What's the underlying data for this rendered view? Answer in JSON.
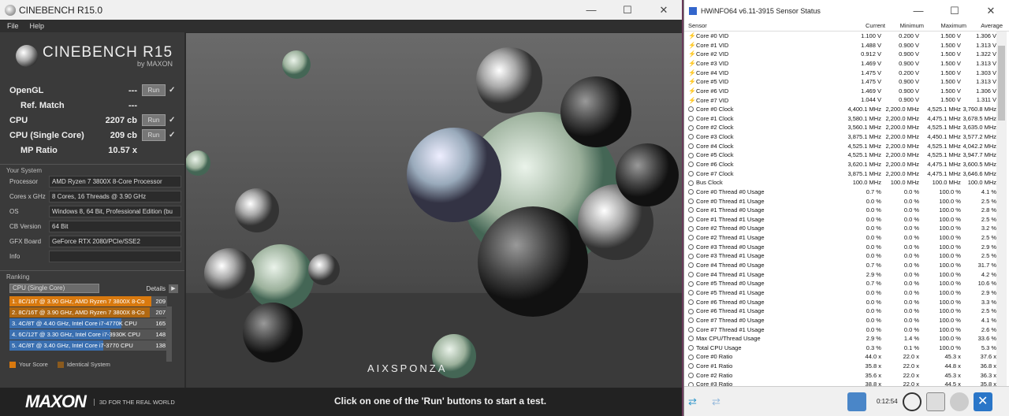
{
  "cinebench": {
    "title": "CINEBENCH R15.0",
    "menu": [
      "File",
      "Help"
    ],
    "logo_main": "CINEBENCH R15",
    "logo_by": "by MAXON",
    "scores": [
      {
        "label": "OpenGL",
        "value": "---",
        "run": "Run",
        "indent": false
      },
      {
        "label": "Ref. Match",
        "value": "---",
        "run": "",
        "indent": true
      },
      {
        "label": "CPU",
        "value": "2207 cb",
        "run": "Run",
        "indent": false
      },
      {
        "label": "CPU (Single Core)",
        "value": "209 cb",
        "run": "Run",
        "indent": false
      },
      {
        "label": "MP Ratio",
        "value": "10.57 x",
        "run": "",
        "indent": true
      }
    ],
    "your_system_label": "Your System",
    "system": [
      {
        "key": "Processor",
        "value": "AMD Ryzen 7 3800X 8-Core Processor"
      },
      {
        "key": "Cores x GHz",
        "value": "8 Cores, 16 Threads @ 3.90 GHz"
      },
      {
        "key": "OS",
        "value": "Windows 8, 64 Bit, Professional Edition (bu"
      },
      {
        "key": "CB Version",
        "value": "64 Bit"
      },
      {
        "key": "GFX Board",
        "value": "GeForce RTX 2080/PCIe/SSE2"
      },
      {
        "key": "Info",
        "value": ""
      }
    ],
    "ranking_label": "Ranking",
    "ranking_select": "CPU (Single Core)",
    "details_label": "Details",
    "ranking": [
      {
        "name": "1. 8C/16T @ 3.90 GHz, AMD Ryzen 7 3800X 8-Co",
        "score": "209",
        "bar": 1.0,
        "color": "#d9790e"
      },
      {
        "name": "2. 8C/16T @ 3.90 GHz, AMD Ryzen 7 3800X 8-Co",
        "score": "207",
        "bar": 0.99,
        "color": "#b06812"
      },
      {
        "name": "3. 4C/8T @ 4.40 GHz, Intel Core i7-4770K CPU",
        "score": "165",
        "bar": 0.79,
        "color": "#3a6fb0"
      },
      {
        "name": "4. 6C/12T @ 3.30 GHz,  Intel Core i7-3930K CPU",
        "score": "148",
        "bar": 0.71,
        "color": "#3a6fb0"
      },
      {
        "name": "5. 4C/8T @ 3.40 GHz,  Intel Core i7-3770 CPU",
        "score": "138",
        "bar": 0.66,
        "color": "#3a6fb0"
      }
    ],
    "legend_your": "Your Score",
    "legend_identical": "Identical System",
    "maxon": "MAXON",
    "slogan": "3D FOR THE REAL WORLD",
    "message": "Click on one of the 'Run' buttons to start a test.",
    "render_logo": "AIXSPONZA"
  },
  "hwinfo": {
    "title": "HWiNFO64 v6.11-3915 Sensor Status",
    "headers": [
      "Sensor",
      "Current",
      "Minimum",
      "Maximum",
      "Average"
    ],
    "rows": [
      {
        "icon": "bolt",
        "name": "Core #0 VID",
        "cur": "1.100 V",
        "min": "0.200 V",
        "max": "1.500 V",
        "avg": "1.306 V"
      },
      {
        "icon": "bolt",
        "name": "Core #1 VID",
        "cur": "1.488 V",
        "min": "0.900 V",
        "max": "1.500 V",
        "avg": "1.313 V"
      },
      {
        "icon": "bolt",
        "name": "Core #2 VID",
        "cur": "0.912 V",
        "min": "0.900 V",
        "max": "1.500 V",
        "avg": "1.322 V"
      },
      {
        "icon": "bolt",
        "name": "Core #3 VID",
        "cur": "1.469 V",
        "min": "0.900 V",
        "max": "1.500 V",
        "avg": "1.313 V"
      },
      {
        "icon": "bolt",
        "name": "Core #4 VID",
        "cur": "1.475 V",
        "min": "0.200 V",
        "max": "1.500 V",
        "avg": "1.303 V"
      },
      {
        "icon": "bolt",
        "name": "Core #5 VID",
        "cur": "1.475 V",
        "min": "0.900 V",
        "max": "1.500 V",
        "avg": "1.313 V"
      },
      {
        "icon": "bolt",
        "name": "Core #6 VID",
        "cur": "1.469 V",
        "min": "0.900 V",
        "max": "1.500 V",
        "avg": "1.306 V"
      },
      {
        "icon": "bolt",
        "name": "Core #7 VID",
        "cur": "1.044 V",
        "min": "0.900 V",
        "max": "1.500 V",
        "avg": "1.311 V"
      },
      {
        "icon": "circle",
        "name": "Core #0 Clock",
        "cur": "4,400.1 MHz",
        "min": "2,200.0 MHz",
        "max": "4,525.1 MHz",
        "avg": "3,760.8 MHz"
      },
      {
        "icon": "circle",
        "name": "Core #1 Clock",
        "cur": "3,580.1 MHz",
        "min": "2,200.0 MHz",
        "max": "4,475.1 MHz",
        "avg": "3,678.5 MHz"
      },
      {
        "icon": "circle",
        "name": "Core #2 Clock",
        "cur": "3,560.1 MHz",
        "min": "2,200.0 MHz",
        "max": "4,525.1 MHz",
        "avg": "3,635.0 MHz"
      },
      {
        "icon": "circle",
        "name": "Core #3 Clock",
        "cur": "3,875.1 MHz",
        "min": "2,200.0 MHz",
        "max": "4,450.1 MHz",
        "avg": "3,577.2 MHz"
      },
      {
        "icon": "circle",
        "name": "Core #4 Clock",
        "cur": "4,525.1 MHz",
        "min": "2,200.0 MHz",
        "max": "4,525.1 MHz",
        "avg": "4,042.2 MHz"
      },
      {
        "icon": "circle",
        "name": "Core #5 Clock",
        "cur": "4,525.1 MHz",
        "min": "2,200.0 MHz",
        "max": "4,525.1 MHz",
        "avg": "3,947.7 MHz"
      },
      {
        "icon": "circle",
        "name": "Core #6 Clock",
        "cur": "3,620.1 MHz",
        "min": "2,200.0 MHz",
        "max": "4,475.1 MHz",
        "avg": "3,600.5 MHz"
      },
      {
        "icon": "circle",
        "name": "Core #7 Clock",
        "cur": "3,875.1 MHz",
        "min": "2,200.0 MHz",
        "max": "4,475.1 MHz",
        "avg": "3,646.6 MHz"
      },
      {
        "icon": "circle",
        "name": "Bus Clock",
        "cur": "100.0 MHz",
        "min": "100.0 MHz",
        "max": "100.0 MHz",
        "avg": "100.0 MHz"
      },
      {
        "icon": "circle",
        "name": "Core #0 Thread #0 Usage",
        "cur": "0.7 %",
        "min": "0.0 %",
        "max": "100.0 %",
        "avg": "4.1 %"
      },
      {
        "icon": "circle",
        "name": "Core #0 Thread #1 Usage",
        "cur": "0.0 %",
        "min": "0.0 %",
        "max": "100.0 %",
        "avg": "2.5 %"
      },
      {
        "icon": "circle",
        "name": "Core #1 Thread #0 Usage",
        "cur": "0.0 %",
        "min": "0.0 %",
        "max": "100.0 %",
        "avg": "2.8 %"
      },
      {
        "icon": "circle",
        "name": "Core #1 Thread #1 Usage",
        "cur": "0.0 %",
        "min": "0.0 %",
        "max": "100.0 %",
        "avg": "2.5 %"
      },
      {
        "icon": "circle",
        "name": "Core #2 Thread #0 Usage",
        "cur": "0.0 %",
        "min": "0.0 %",
        "max": "100.0 %",
        "avg": "3.2 %"
      },
      {
        "icon": "circle",
        "name": "Core #2 Thread #1 Usage",
        "cur": "0.0 %",
        "min": "0.0 %",
        "max": "100.0 %",
        "avg": "2.5 %"
      },
      {
        "icon": "circle",
        "name": "Core #3 Thread #0 Usage",
        "cur": "0.0 %",
        "min": "0.0 %",
        "max": "100.0 %",
        "avg": "2.9 %"
      },
      {
        "icon": "circle",
        "name": "Core #3 Thread #1 Usage",
        "cur": "0.0 %",
        "min": "0.0 %",
        "max": "100.0 %",
        "avg": "2.5 %"
      },
      {
        "icon": "circle",
        "name": "Core #4 Thread #0 Usage",
        "cur": "0.7 %",
        "min": "0.0 %",
        "max": "100.0 %",
        "avg": "31.7 %"
      },
      {
        "icon": "circle",
        "name": "Core #4 Thread #1 Usage",
        "cur": "2.9 %",
        "min": "0.0 %",
        "max": "100.0 %",
        "avg": "4.2 %"
      },
      {
        "icon": "circle",
        "name": "Core #5 Thread #0 Usage",
        "cur": "0.7 %",
        "min": "0.0 %",
        "max": "100.0 %",
        "avg": "10.6 %"
      },
      {
        "icon": "circle",
        "name": "Core #5 Thread #1 Usage",
        "cur": "0.0 %",
        "min": "0.0 %",
        "max": "100.0 %",
        "avg": "2.9 %"
      },
      {
        "icon": "circle",
        "name": "Core #6 Thread #0 Usage",
        "cur": "0.0 %",
        "min": "0.0 %",
        "max": "100.0 %",
        "avg": "3.3 %"
      },
      {
        "icon": "circle",
        "name": "Core #6 Thread #1 Usage",
        "cur": "0.0 %",
        "min": "0.0 %",
        "max": "100.0 %",
        "avg": "2.5 %"
      },
      {
        "icon": "circle",
        "name": "Core #7 Thread #0 Usage",
        "cur": "0.0 %",
        "min": "0.0 %",
        "max": "100.0 %",
        "avg": "4.1 %"
      },
      {
        "icon": "circle",
        "name": "Core #7 Thread #1 Usage",
        "cur": "0.0 %",
        "min": "0.0 %",
        "max": "100.0 %",
        "avg": "2.6 %"
      },
      {
        "icon": "circle",
        "name": "Max CPU/Thread Usage",
        "cur": "2.9 %",
        "min": "1.4 %",
        "max": "100.0 %",
        "avg": "33.6 %"
      },
      {
        "icon": "circle",
        "name": "Total CPU Usage",
        "cur": "0.3 %",
        "min": "0.1 %",
        "max": "100.0 %",
        "avg": "5.3 %"
      },
      {
        "icon": "circle",
        "name": "Core #0 Ratio",
        "cur": "44.0 x",
        "min": "22.0 x",
        "max": "45.3 x",
        "avg": "37.6 x"
      },
      {
        "icon": "circle",
        "name": "Core #1 Ratio",
        "cur": "35.8 x",
        "min": "22.0 x",
        "max": "44.8 x",
        "avg": "36.8 x"
      },
      {
        "icon": "circle",
        "name": "Core #2 Ratio",
        "cur": "35.6 x",
        "min": "22.0 x",
        "max": "45.3 x",
        "avg": "36.3 x"
      },
      {
        "icon": "circle",
        "name": "Core #3 Ratio",
        "cur": "38.8 x",
        "min": "22.0 x",
        "max": "44.5 x",
        "avg": "35.8 x"
      }
    ],
    "timer": "0:12:54"
  }
}
